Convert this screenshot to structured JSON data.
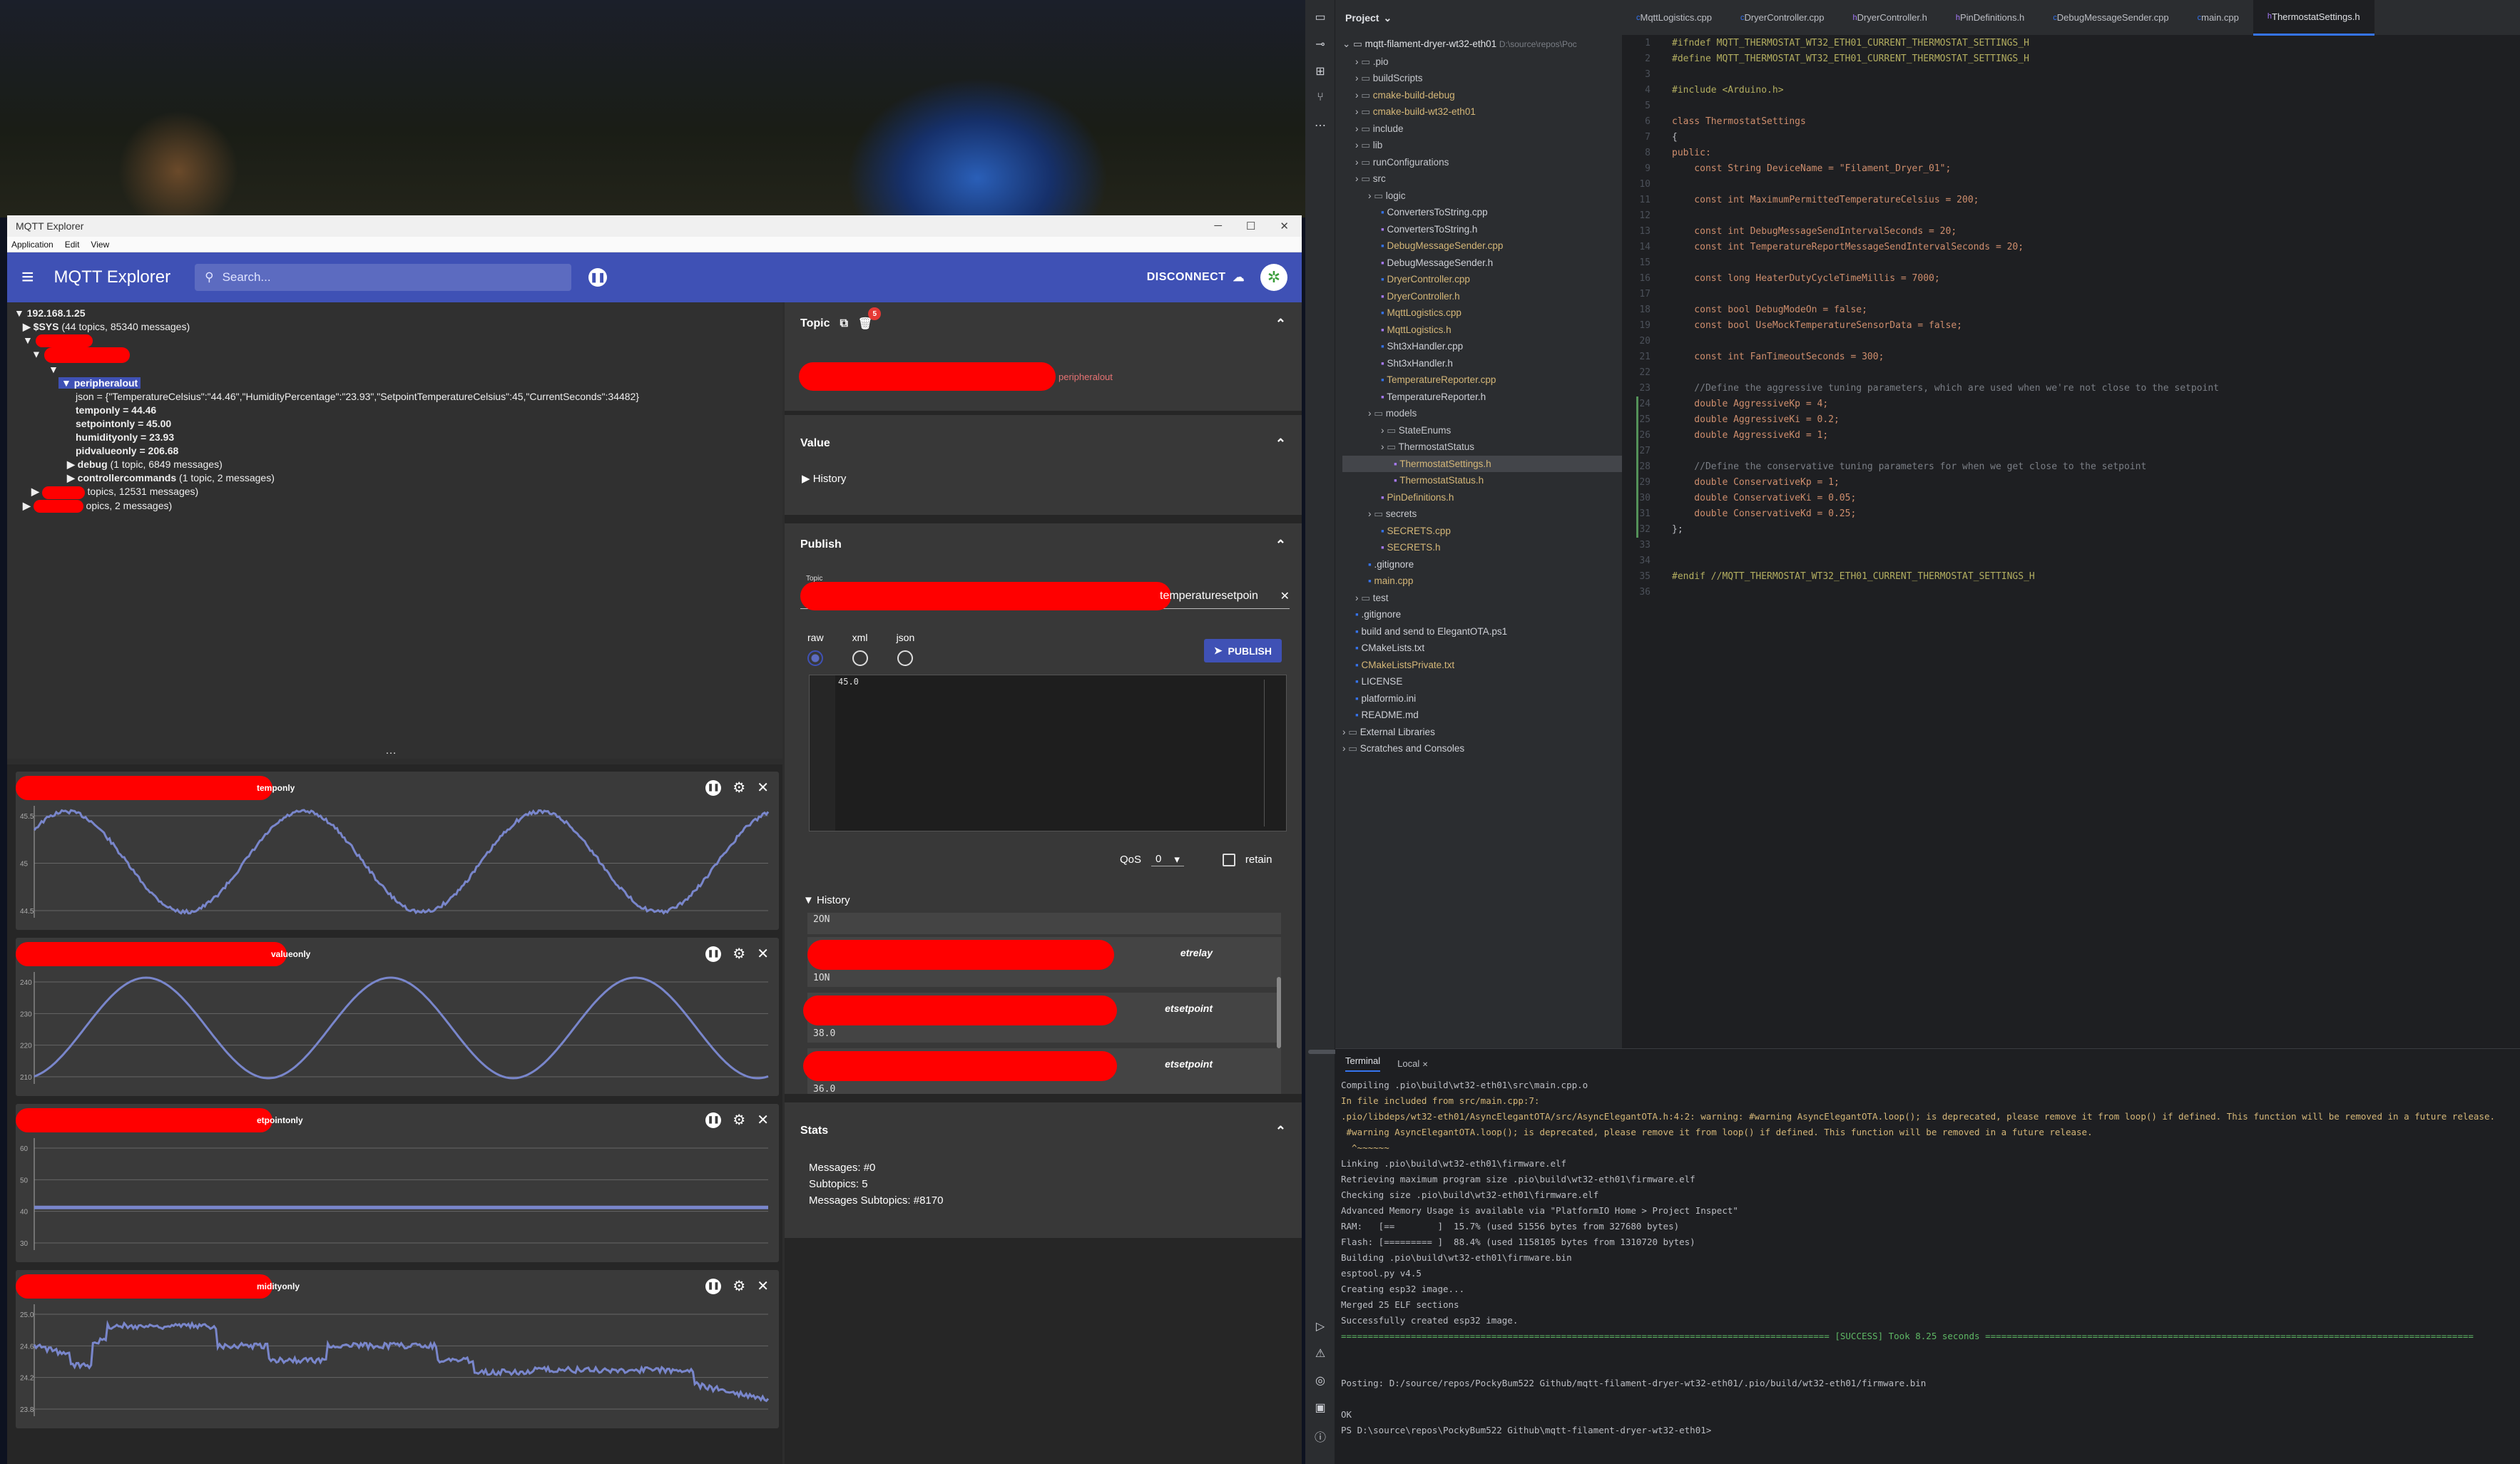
{
  "mqtt": {
    "window_title": "MQTT Explorer",
    "menu": [
      "Application",
      "Edit",
      "View"
    ],
    "app_title": "MQTT Explorer",
    "search_placeholder": "Search...",
    "disconnect_label": "DISCONNECT",
    "tree": {
      "root": "192.168.1.25",
      "sys": "$SYS",
      "sys_count": " (44 topics, 85340 messages)",
      "selected": "peripheralout",
      "json_line": "json = {\"TemperatureCelsius\":\"44.46\",\"HumidityPercentage\":\"23.93\",\"SetpointTemperatureCelsius\":45,\"CurrentSeconds\":34482}",
      "temponly": "temponly = 44.46",
      "setpointonly": "setpointonly = 45.00",
      "humidityonly": "humidityonly = 23.93",
      "pidvalueonly": "pidvalueonly = 206.68",
      "debug": "debug",
      "debug_count": " (1 topic, 6849 messages)",
      "controllercommands": "controllercommands",
      "cc_count": " (1 topic, 2 messages)",
      "other1": "topics, 12531 messages)",
      "other2": "opics, 2 messages)"
    },
    "charts": [
      {
        "title": "temponly",
        "yticks": [
          "45.5",
          "45",
          "44.5"
        ]
      },
      {
        "title": "valueonly",
        "yticks": [
          "240",
          "230",
          "220",
          "210"
        ]
      },
      {
        "title": "etpointonly",
        "yticks": [
          "60",
          "50",
          "40",
          "30"
        ]
      },
      {
        "title": "midityonly",
        "yticks": [
          "25.0",
          "24.6",
          "24.2",
          "23.8"
        ]
      }
    ],
    "topic_panel": {
      "title": "Topic",
      "badge": "5",
      "suffix": "peripheralout"
    },
    "value_panel": {
      "title": "Value",
      "history": "History"
    },
    "publish_panel": {
      "title": "Publish",
      "topic_label": "Topic",
      "topic_value": "temperaturesetpoin",
      "formats": [
        "raw",
        "xml",
        "json"
      ],
      "publish_label": "PUBLISH",
      "editor_value": "45.0",
      "qos_label": "QoS",
      "qos_value": "0",
      "retain_label": "retain",
      "history_label": "History",
      "history_items": [
        {
          "value": "2ON",
          "topic": ""
        },
        {
          "value": "1ON",
          "topic": "etrelay"
        },
        {
          "value": "38.0",
          "topic": "etsetpoint"
        },
        {
          "value": "36.0",
          "topic": "etsetpoint"
        }
      ]
    },
    "stats_panel": {
      "title": "Stats",
      "messages": "Messages: #0",
      "subtopics": "Subtopics: 5",
      "messages_subtopics": "Messages Subtopics: #8170"
    }
  },
  "ide": {
    "project_label": "Project",
    "tabs": [
      "MqttLogistics.cpp",
      "DryerController.cpp",
      "DryerController.h",
      "PinDefinitions.h",
      "DebugMessageSender.cpp",
      "main.cpp",
      "ThermostatSettings.h"
    ],
    "project_root": "mqtt-filament-dryer-wt32-eth01",
    "project_path": "D:\\source\\repos\\Poc",
    "tree": [
      {
        "d": 1,
        "t": "folder",
        "n": ".pio",
        "c": "fold"
      },
      {
        "d": 1,
        "t": "folder",
        "n": "buildScripts",
        "c": "fold"
      },
      {
        "d": 1,
        "t": "folder",
        "n": "cmake-build-debug",
        "c": "warn"
      },
      {
        "d": 1,
        "t": "folder",
        "n": "cmake-build-wt32-eth01",
        "c": "warn"
      },
      {
        "d": 1,
        "t": "folder",
        "n": "include",
        "c": "fold"
      },
      {
        "d": 1,
        "t": "folder",
        "n": "lib",
        "c": "fold"
      },
      {
        "d": 1,
        "t": "folder",
        "n": "runConfigurations",
        "c": "fold"
      },
      {
        "d": 1,
        "t": "folder",
        "n": "src",
        "c": "fold"
      },
      {
        "d": 2,
        "t": "folder",
        "n": "logic",
        "c": "fold"
      },
      {
        "d": 3,
        "t": "file",
        "n": "ConvertersToString.cpp",
        "c": "cpp"
      },
      {
        "d": 3,
        "t": "file",
        "n": "ConvertersToString.h",
        "c": "cpp"
      },
      {
        "d": 3,
        "t": "file",
        "n": "DebugMessageSender.cpp",
        "c": "warn"
      },
      {
        "d": 3,
        "t": "file",
        "n": "DebugMessageSender.h",
        "c": "cpp"
      },
      {
        "d": 3,
        "t": "file",
        "n": "DryerController.cpp",
        "c": "warn"
      },
      {
        "d": 3,
        "t": "file",
        "n": "DryerController.h",
        "c": "warn"
      },
      {
        "d": 3,
        "t": "file",
        "n": "MqttLogistics.cpp",
        "c": "warn"
      },
      {
        "d": 3,
        "t": "file",
        "n": "MqttLogistics.h",
        "c": "warn"
      },
      {
        "d": 3,
        "t": "file",
        "n": "Sht3xHandler.cpp",
        "c": "cpp"
      },
      {
        "d": 3,
        "t": "file",
        "n": "Sht3xHandler.h",
        "c": "cpp"
      },
      {
        "d": 3,
        "t": "file",
        "n": "TemperatureReporter.cpp",
        "c": "warn"
      },
      {
        "d": 3,
        "t": "file",
        "n": "TemperatureReporter.h",
        "c": "cpp"
      },
      {
        "d": 2,
        "t": "folder",
        "n": "models",
        "c": "fold"
      },
      {
        "d": 3,
        "t": "folder",
        "n": "StateEnums",
        "c": "fold"
      },
      {
        "d": 3,
        "t": "folder",
        "n": "ThermostatStatus",
        "c": "fold"
      },
      {
        "d": 4,
        "t": "file",
        "n": "ThermostatSettings.h",
        "c": "warn"
      },
      {
        "d": 4,
        "t": "file",
        "n": "ThermostatStatus.h",
        "c": "warn"
      },
      {
        "d": 3,
        "t": "file",
        "n": "PinDefinitions.h",
        "c": "warn"
      },
      {
        "d": 2,
        "t": "folder",
        "n": "secrets",
        "c": "fold"
      },
      {
        "d": 3,
        "t": "file",
        "n": "SECRETS.cpp",
        "c": "warn"
      },
      {
        "d": 3,
        "t": "file",
        "n": "SECRETS.h",
        "c": "warn"
      },
      {
        "d": 2,
        "t": "file",
        "n": ".gitignore",
        "c": "cpp"
      },
      {
        "d": 2,
        "t": "file",
        "n": "main.cpp",
        "c": "warn"
      },
      {
        "d": 1,
        "t": "folder",
        "n": "test",
        "c": "fold"
      },
      {
        "d": 1,
        "t": "file",
        "n": ".gitignore",
        "c": "cpp"
      },
      {
        "d": 1,
        "t": "file",
        "n": "build and send to ElegantOTA.ps1",
        "c": "cpp"
      },
      {
        "d": 1,
        "t": "file",
        "n": "CMakeLists.txt",
        "c": "cpp"
      },
      {
        "d": 1,
        "t": "file",
        "n": "CMakeListsPrivate.txt",
        "c": "warn"
      },
      {
        "d": 1,
        "t": "file",
        "n": "LICENSE",
        "c": "cpp"
      },
      {
        "d": 1,
        "t": "file",
        "n": "platformio.ini",
        "c": "cpp"
      },
      {
        "d": 1,
        "t": "file",
        "n": "README.md",
        "c": "cpp"
      },
      {
        "d": 0,
        "t": "folder",
        "n": "External Libraries",
        "c": "cpp"
      },
      {
        "d": 0,
        "t": "folder",
        "n": "Scratches and Consoles",
        "c": "cpp"
      }
    ],
    "code": [
      "#ifndef MQTT_THERMOSTAT_WT32_ETH01_CURRENT_THERMOSTAT_SETTINGS_H",
      "#define MQTT_THERMOSTAT_WT32_ETH01_CURRENT_THERMOSTAT_SETTINGS_H",
      "",
      "#include <Arduino.h>",
      "",
      "class ThermostatSettings",
      "{",
      "public:",
      "    const String DeviceName = \"Filament_Dryer_01\";",
      "",
      "    const int MaximumPermittedTemperatureCelsius = 200;",
      "",
      "    const int DebugMessageSendIntervalSeconds = 20;",
      "    const int TemperatureReportMessageSendIntervalSeconds = 20;",
      "",
      "    const long HeaterDutyCycleTimeMillis = 7000;",
      "",
      "    const bool DebugModeOn = false;",
      "    const bool UseMockTemperatureSensorData = false;",
      "",
      "    const int FanTimeoutSeconds = 300;",
      "",
      "    //Define the aggressive tuning parameters, which are used when we're not close to the setpoint",
      "    double AggressiveKp = 4;",
      "    double AggressiveKi = 0.2;",
      "    double AggressiveKd = 1;",
      "",
      "    //Define the conservative tuning parameters for when we get close to the setpoint",
      "    double ConservativeKp = 1;",
      "    double ConservativeKi = 0.05;",
      "    double ConservativeKd = 0.25;",
      "};",
      "",
      "",
      "#endif //MQTT_THERMOSTAT_WT32_ETH01_CURRENT_THERMOSTAT_SETTINGS_H",
      ""
    ],
    "terminal_tabs": [
      "Terminal",
      "Local"
    ],
    "terminal": [
      {
        "c": "",
        "t": "Compiling .pio\\build\\wt32-eth01\\src\\main.cpp.o"
      },
      {
        "c": "warn",
        "t": "In file included from src/main.cpp:7:"
      },
      {
        "c": "warn",
        "t": ".pio/libdeps/wt32-eth01/AsyncElegantOTA/src/AsyncElegantOTA.h:4:2: warning: #warning AsyncElegantOTA.loop(); is deprecated, please remove it from loop() if defined. This function will be removed in a future release."
      },
      {
        "c": "warn",
        "t": " #warning AsyncElegantOTA.loop(); is deprecated, please remove it from loop() if defined. This function will be removed in a future release."
      },
      {
        "c": "warn",
        "t": "  ^~~~~~~"
      },
      {
        "c": "",
        "t": "Linking .pio\\build\\wt32-eth01\\firmware.elf"
      },
      {
        "c": "",
        "t": "Retrieving maximum program size .pio\\build\\wt32-eth01\\firmware.elf"
      },
      {
        "c": "",
        "t": "Checking size .pio\\build\\wt32-eth01\\firmware.elf"
      },
      {
        "c": "",
        "t": "Advanced Memory Usage is available via \"PlatformIO Home > Project Inspect\""
      },
      {
        "c": "",
        "t": "RAM:   [==        ]  15.7% (used 51556 bytes from 327680 bytes)"
      },
      {
        "c": "",
        "t": "Flash: [========= ]  88.4% (used 1158105 bytes from 1310720 bytes)"
      },
      {
        "c": "",
        "t": "Building .pio\\build\\wt32-eth01\\firmware.bin"
      },
      {
        "c": "",
        "t": "esptool.py v4.5"
      },
      {
        "c": "",
        "t": "Creating esp32 image..."
      },
      {
        "c": "",
        "t": "Merged 25 ELF sections"
      },
      {
        "c": "",
        "t": "Successfully created esp32 image."
      },
      {
        "c": "succ",
        "t": "=========================================================================================== [SUCCESS] Took 8.25 seconds ==========================================================================================="
      },
      {
        "c": "",
        "t": ""
      },
      {
        "c": "",
        "t": ""
      },
      {
        "c": "",
        "t": "Posting: D:/source/repos/PockyBum522 Github/mqtt-filament-dryer-wt32-eth01/.pio/build/wt32-eth01/firmware.bin"
      },
      {
        "c": "",
        "t": ""
      },
      {
        "c": "",
        "t": "OK"
      },
      {
        "c": "",
        "t": "PS D:\\source\\repos\\PockyBum522 Github\\mqtt-filament-dryer-wt32-eth01> "
      }
    ]
  },
  "colors": {
    "accent": "#3f51b5",
    "series": "#7986cb",
    "redaction": "#ff0000"
  }
}
